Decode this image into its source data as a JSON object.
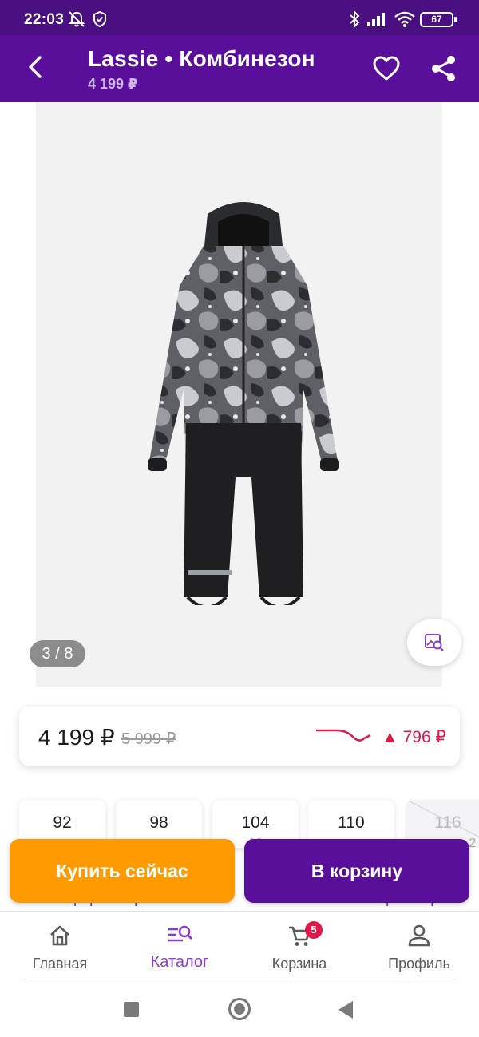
{
  "status_bar": {
    "time": "22:03",
    "battery": "67",
    "icons": [
      "mute-icon",
      "shield-icon",
      "bluetooth-icon",
      "signal-icon",
      "wifi-icon",
      "battery-icon"
    ]
  },
  "header": {
    "title": "Lassie • Комбинезон",
    "subtitle": "4 199 ₽",
    "icons": [
      "back-arrow-icon",
      "heart-icon",
      "share-icon"
    ]
  },
  "gallery": {
    "counter": "3 / 8",
    "image_colors": {
      "background": "#f2f2f2",
      "suit_dark": "#1f1f22",
      "suit_pattern": "#8e9097"
    }
  },
  "price_card": {
    "price": "4 199 ₽",
    "old_price": "5 999 ₽",
    "change": "▲ 796 ₽",
    "change_color": "#e0184a"
  },
  "sizes": [
    {
      "size": "92",
      "sub": "",
      "available": true
    },
    {
      "size": "98",
      "sub": "",
      "available": true
    },
    {
      "size": "104",
      "sub": "10",
      "available": true
    },
    {
      "size": "110",
      "sub": "",
      "available": true
    },
    {
      "size": "116",
      "sub": "2",
      "available": false
    }
  ],
  "links": {
    "size_table": "Таблица размеров",
    "all_sizes": "Все размеры"
  },
  "actions": {
    "buy_now": "Купить сейчас",
    "add_to_cart": "В корзину",
    "buy_color": "#ff9a00",
    "cart_color": "#5a0f9a"
  },
  "bottom_nav": {
    "items": [
      {
        "label": "Главная",
        "icon": "home-icon",
        "active": false
      },
      {
        "label": "Каталог",
        "icon": "catalog-search-icon",
        "active": true
      },
      {
        "label": "Корзина",
        "icon": "cart-icon",
        "active": false,
        "badge": "5"
      },
      {
        "label": "Профиль",
        "icon": "profile-icon",
        "active": false
      }
    ]
  },
  "colors": {
    "brand": "#5a0f9a",
    "status_bar": "#4a0f80",
    "accent": "#ff9a00"
  }
}
